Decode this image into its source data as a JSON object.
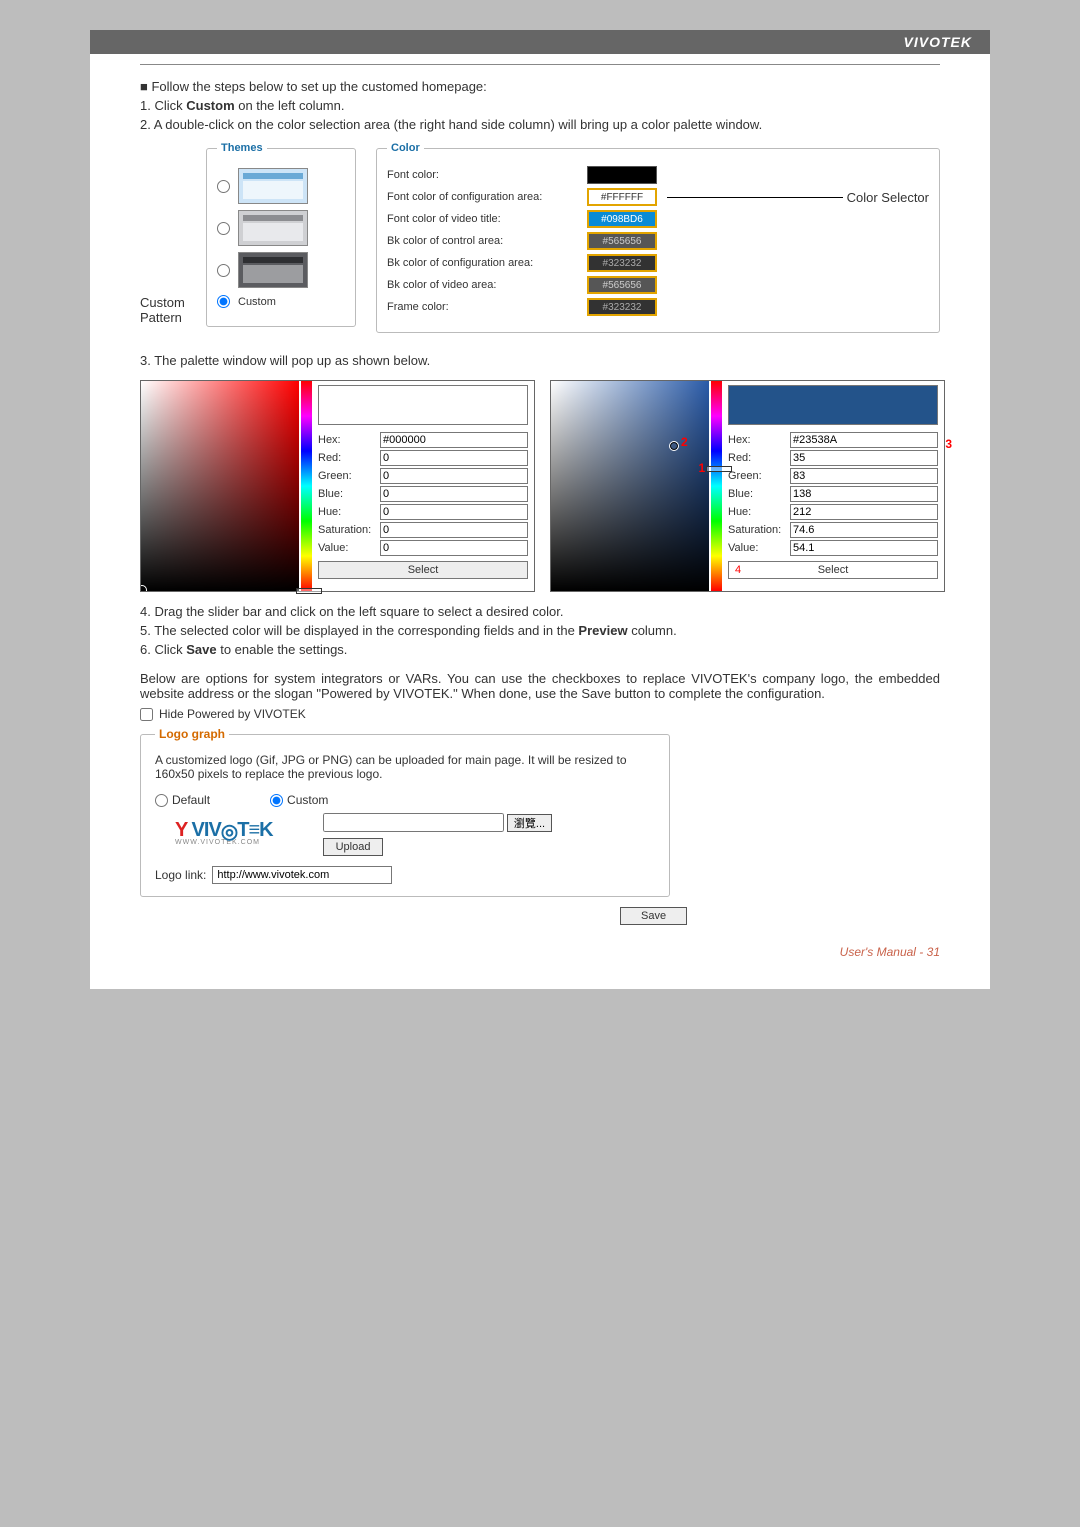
{
  "header": {
    "brand": "VIVOTEK"
  },
  "intro": {
    "line0": "Follow the steps below to set up the customed homepage:",
    "step1a": "1. Click ",
    "step1b": "Custom",
    "step1c": " on the left column.",
    "step2": "2. A double-click on the color selection area (the right hand side column) will bring up a color palette window."
  },
  "themes": {
    "legend": "Themes",
    "customLabel": "Custom"
  },
  "callouts": {
    "customPattern": "Custom Pattern",
    "colorSelector": "Color Selector"
  },
  "colors": {
    "legend": "Color",
    "rows": {
      "font": "Font color:",
      "confFont": "Font color of configuration area:",
      "videoTitleFont": "Font color of video title:",
      "controlBk": "Bk color of control area:",
      "confBk": "Bk color of configuration area:",
      "videoBk": "Bk color of video area:",
      "frame": "Frame color:"
    },
    "values": {
      "font": "",
      "confFont": "#FFFFFF",
      "videoTitleFont": "#098BD6",
      "controlBk": "#565656",
      "confBk": "#323232",
      "videoBk": "#565656",
      "frame": "#323232"
    }
  },
  "step3": "3. The palette window will pop up as shown below.",
  "palette": {
    "labels": {
      "hex": "Hex:",
      "red": "Red:",
      "green": "Green:",
      "blue": "Blue:",
      "hue": "Hue:",
      "sat": "Saturation:",
      "val": "Value:",
      "select": "Select"
    },
    "p1": {
      "hex": "#000000",
      "red": "0",
      "green": "0",
      "blue": "0",
      "hue": "0",
      "sat": "0",
      "val": "0"
    },
    "p2": {
      "hex": "#23538A",
      "red": "35",
      "green": "83",
      "blue": "138",
      "hue": "212",
      "sat": "74.6",
      "val": "54.1"
    },
    "marks": {
      "n1": "1",
      "n2": "2",
      "n3": "3",
      "n4": "4"
    }
  },
  "step4": "4. Drag the slider bar and click on the left square to select a desired color.",
  "step5a": "5. The selected color will be displayed in the corresponding fields and in the ",
  "step5b": "Preview",
  "step5c": " column.",
  "step6a": "6. Click ",
  "step6b": "Save",
  "step6c": " to enable the settings.",
  "vars": "Below are options for system integrators or VARs. You can use the checkboxes to replace VIVOTEK's company logo, the embedded website address or the slogan \"Powered by VIVOTEK.\" When done, use the Save button to complete the configuration.",
  "hideLabel": "Hide Powered by VIVOTEK",
  "logo": {
    "legend": "Logo graph",
    "desc": "A customized logo (Gif, JPG or PNG) can be uploaded for main page. It will be resized to 160x50 pixels to replace the previous logo.",
    "default": "Default",
    "custom": "Custom",
    "logotext": "VIV TEK",
    "logosub": "WWW.VIVOTEK.COM",
    "browse": "瀏覽...",
    "upload": "Upload",
    "linkLabel": "Logo link:",
    "linkVal": "http://www.vivotek.com"
  },
  "save": "Save",
  "footer": "User's Manual - 31"
}
